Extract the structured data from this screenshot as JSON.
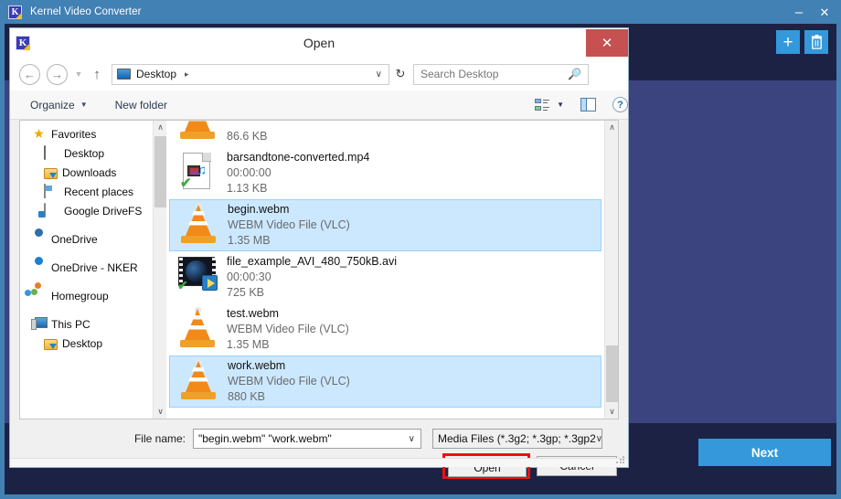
{
  "app": {
    "title": "Kernel Video Converter",
    "icon": "kernel-app-icon",
    "minimize_label": "–",
    "close_label": "✕",
    "add_button_label": "+",
    "delete_button_icon": "trash-icon",
    "next_button_label": "Next",
    "colors": {
      "titlebar": "#4281b4",
      "dark_panel": "#1c2244",
      "center_panel": "#3c4480",
      "accent": "#3498db"
    }
  },
  "dialog": {
    "title": "Open",
    "icon": "kernel-app-icon",
    "close_label": "✕",
    "close_color": "#c75050",
    "nav": {
      "back_label": "←",
      "forward_label": "→",
      "recent_label": "▼",
      "up_label": "↑",
      "refresh_label": "↻"
    },
    "address": {
      "text": "Desktop",
      "separator": "▸",
      "chevron": "∨"
    },
    "search": {
      "placeholder": "Search Desktop",
      "icon": "search-icon"
    },
    "toolbar": {
      "organize_label": "Organize",
      "organize_caret": "▼",
      "new_folder_label": "New folder",
      "view_caret": "▼",
      "view_icon": "view-options-icon",
      "preview_pane_icon": "preview-pane-icon",
      "help_label": "?"
    },
    "nav_pane": {
      "items": [
        {
          "label": "Favorites",
          "icon": "star-icon",
          "level": "root"
        },
        {
          "label": "Desktop",
          "icon": "desktop-icon",
          "level": "child"
        },
        {
          "label": "Downloads",
          "icon": "downloads-folder-icon",
          "level": "child"
        },
        {
          "label": "Recent places",
          "icon": "recent-places-icon",
          "level": "child"
        },
        {
          "label": "Google DriveFS",
          "icon": "drive-icon",
          "level": "child"
        },
        {
          "label": "OneDrive",
          "icon": "onedrive-icon",
          "level": "root"
        },
        {
          "label": "OneDrive - NKER",
          "icon": "onedrive-icon",
          "level": "root"
        },
        {
          "label": "Homegroup",
          "icon": "homegroup-icon",
          "level": "root"
        },
        {
          "label": "This PC",
          "icon": "this-pc-icon",
          "level": "root"
        },
        {
          "label": "Desktop",
          "icon": "folder-icon",
          "level": "child"
        }
      ],
      "scroll_up": "∧",
      "scroll_down": "∨"
    },
    "files": {
      "partial_top": {
        "size": "86.6 KB",
        "icon": "vlc-icon"
      },
      "items": [
        {
          "name": "barsandtone-converted.mp4",
          "duration": "00:00:00",
          "size": "1.13 KB",
          "icon": "mp4-doc-icon",
          "selected": false
        },
        {
          "name": "begin.webm",
          "duration": "WEBM Video File (VLC)",
          "size": "1.35 MB",
          "icon": "vlc-icon",
          "selected": true
        },
        {
          "name": "file_example_AVI_480_750kB.avi",
          "duration": "00:00:30",
          "size": "725 KB",
          "icon": "avi-icon",
          "selected": false
        },
        {
          "name": "test.webm",
          "duration": "WEBM Video File (VLC)",
          "size": "1.35 MB",
          "icon": "vlc-icon",
          "selected": false
        },
        {
          "name": "work.webm",
          "duration": "WEBM Video File (VLC)",
          "size": "880 KB",
          "icon": "vlc-icon",
          "selected": true
        }
      ],
      "scroll_up": "∧",
      "scroll_down": "∨"
    },
    "form": {
      "file_name_label": "File name:",
      "file_name_value": "\"begin.webm\" \"work.webm\"",
      "file_name_chevron": "∨",
      "file_type_value": "Media Files (*.3g2; *.3gp; *.3gp2",
      "file_type_chevron": "∨"
    },
    "buttons": {
      "open_label": "Open",
      "open_highlight_color": "#ee1111",
      "cancel_label": "Cancel"
    }
  }
}
